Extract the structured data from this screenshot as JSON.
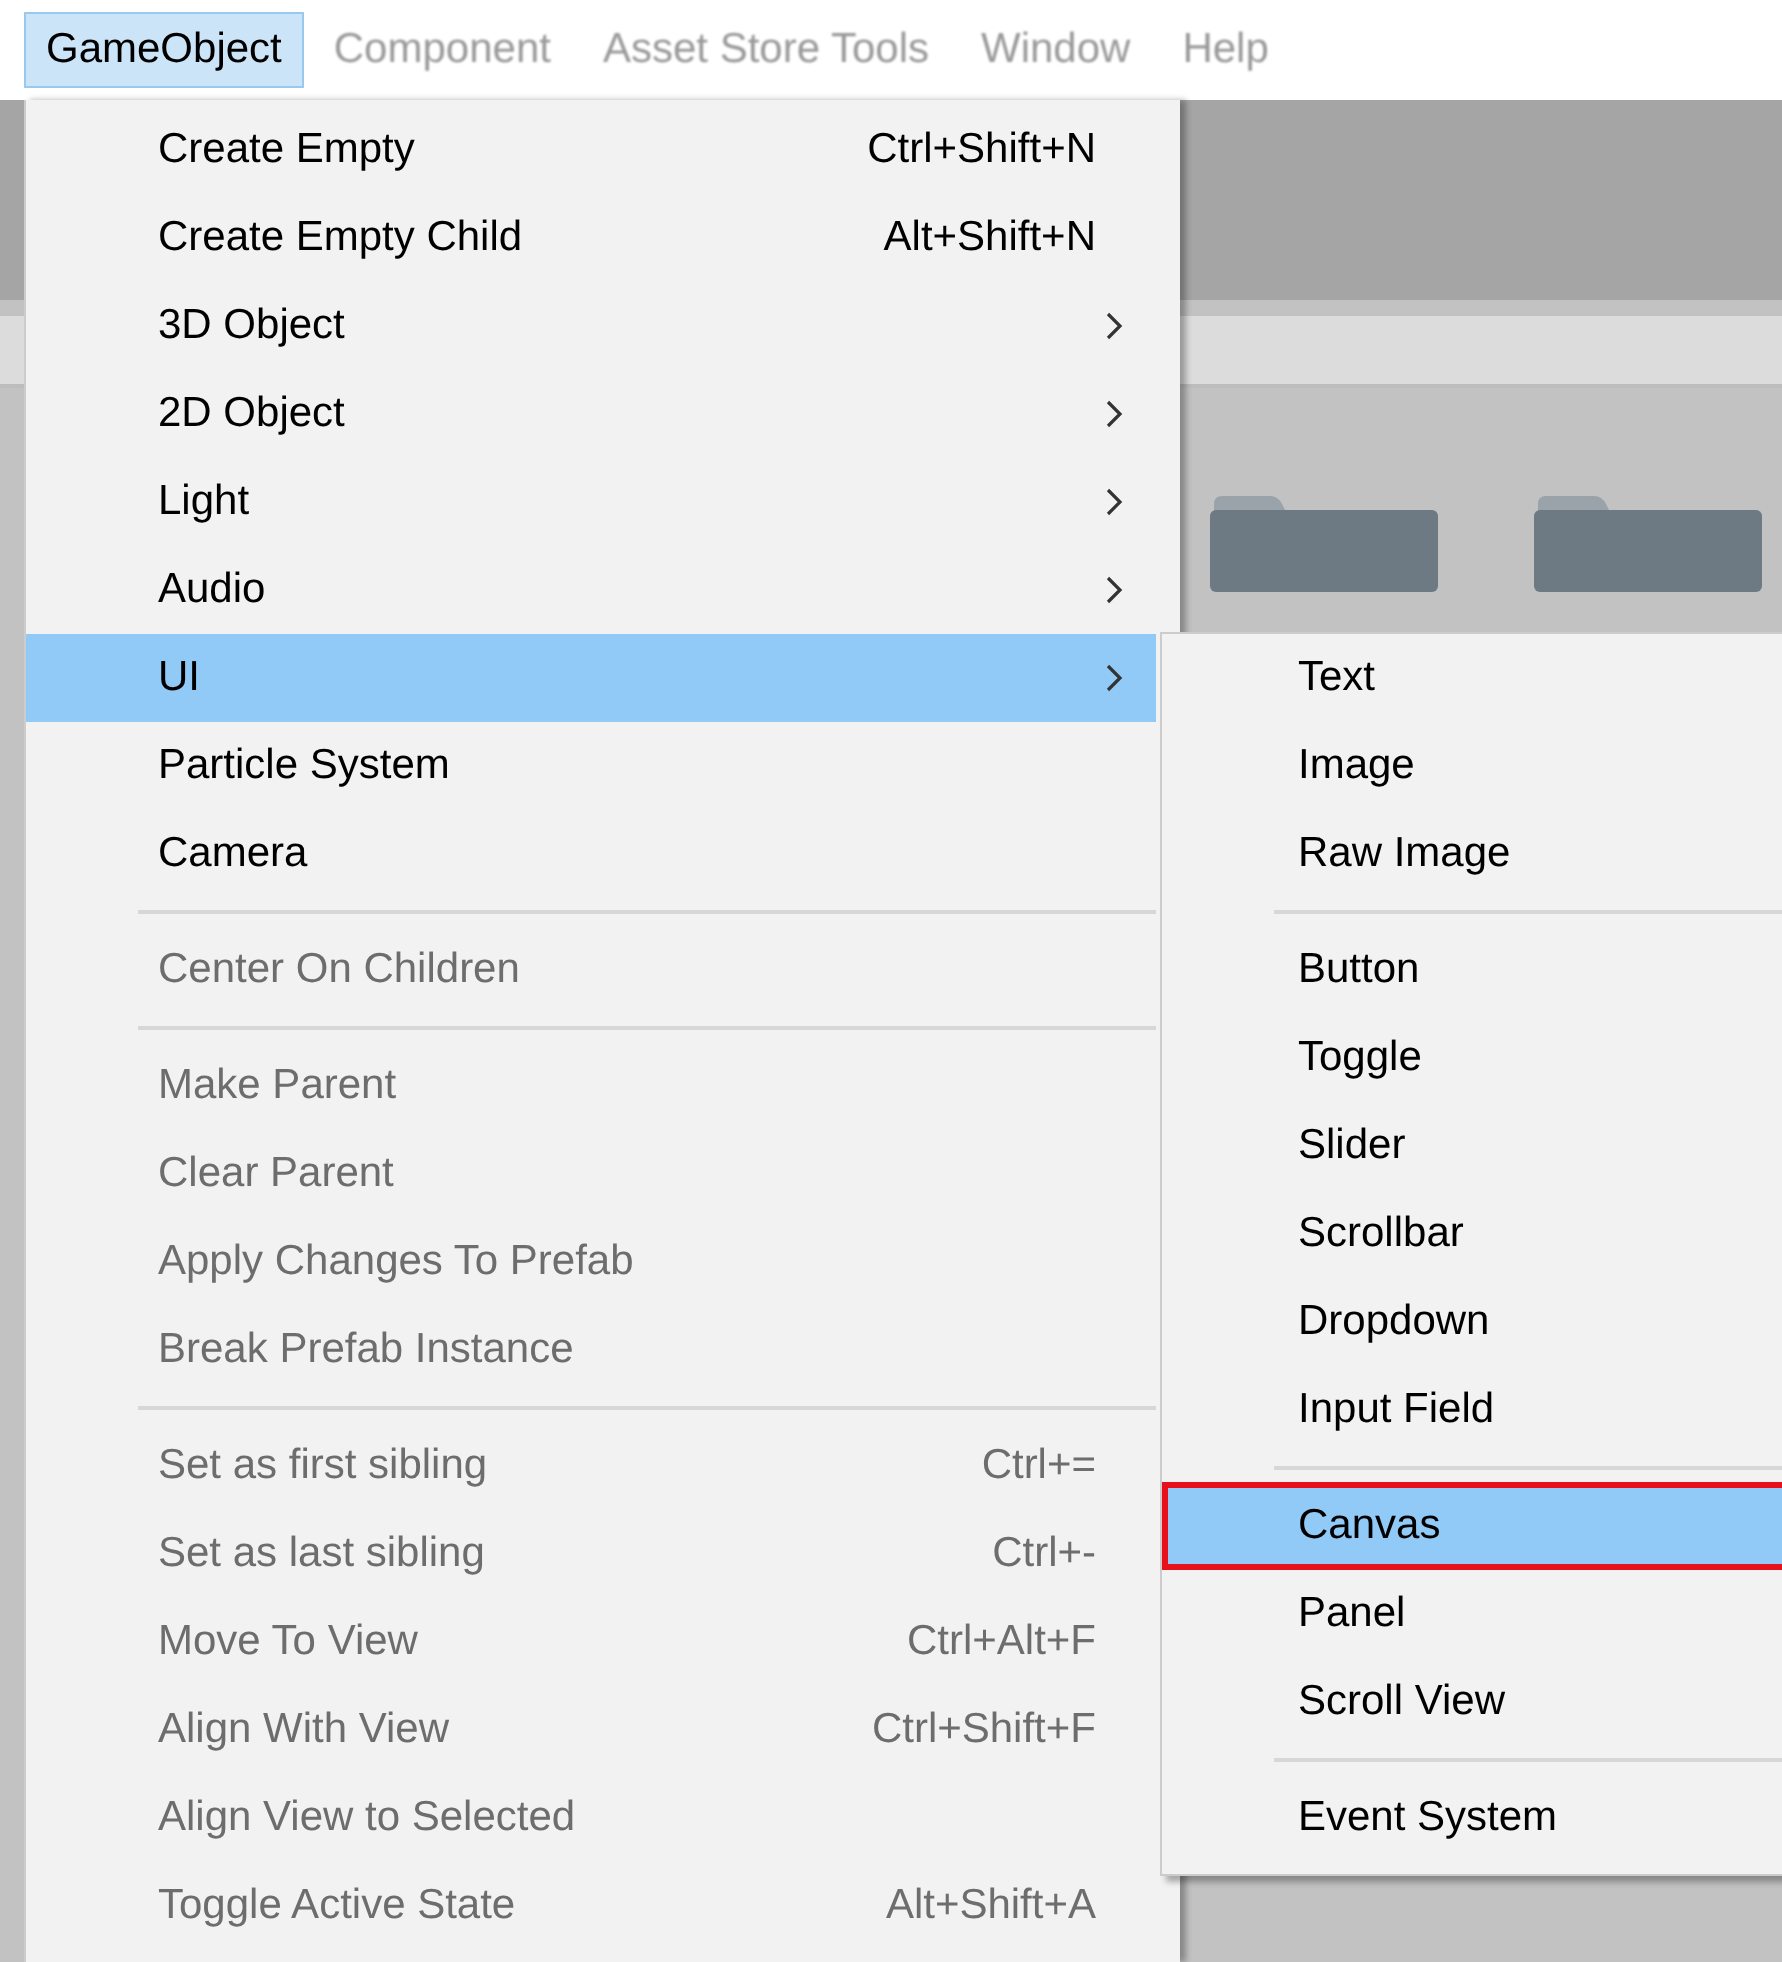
{
  "menu_bar": [
    {
      "label": "GameObject",
      "selected": true,
      "disabled": false
    },
    {
      "label": "Component",
      "selected": false,
      "disabled": true
    },
    {
      "label": "Asset Store Tools",
      "selected": false,
      "disabled": true
    },
    {
      "label": "Window",
      "selected": false,
      "disabled": true
    },
    {
      "label": "Help",
      "selected": false,
      "disabled": true
    }
  ],
  "main_menu": {
    "items": [
      {
        "kind": "item",
        "label": "Create Empty",
        "shortcut": "Ctrl+Shift+N",
        "submenu": false,
        "disabled": false,
        "selected": false
      },
      {
        "kind": "item",
        "label": "Create Empty Child",
        "shortcut": "Alt+Shift+N",
        "submenu": false,
        "disabled": false,
        "selected": false
      },
      {
        "kind": "item",
        "label": "3D Object",
        "submenu": true,
        "disabled": false,
        "selected": false
      },
      {
        "kind": "item",
        "label": "2D Object",
        "submenu": true,
        "disabled": false,
        "selected": false
      },
      {
        "kind": "item",
        "label": "Light",
        "submenu": true,
        "disabled": false,
        "selected": false
      },
      {
        "kind": "item",
        "label": "Audio",
        "submenu": true,
        "disabled": false,
        "selected": false
      },
      {
        "kind": "item",
        "label": "UI",
        "submenu": true,
        "disabled": false,
        "selected": true
      },
      {
        "kind": "item",
        "label": "Particle System",
        "submenu": false,
        "disabled": false,
        "selected": false
      },
      {
        "kind": "item",
        "label": "Camera",
        "submenu": false,
        "disabled": false,
        "selected": false
      },
      {
        "kind": "separator"
      },
      {
        "kind": "item",
        "label": "Center On Children",
        "submenu": false,
        "disabled": true,
        "selected": false
      },
      {
        "kind": "separator"
      },
      {
        "kind": "item",
        "label": "Make Parent",
        "submenu": false,
        "disabled": true,
        "selected": false
      },
      {
        "kind": "item",
        "label": "Clear Parent",
        "submenu": false,
        "disabled": true,
        "selected": false
      },
      {
        "kind": "item",
        "label": "Apply Changes To Prefab",
        "submenu": false,
        "disabled": true,
        "selected": false
      },
      {
        "kind": "item",
        "label": "Break Prefab Instance",
        "submenu": false,
        "disabled": true,
        "selected": false
      },
      {
        "kind": "separator"
      },
      {
        "kind": "item",
        "label": "Set as first sibling",
        "shortcut": "Ctrl+=",
        "submenu": false,
        "disabled": true,
        "selected": false
      },
      {
        "kind": "item",
        "label": "Set as last sibling",
        "shortcut": "Ctrl+-",
        "submenu": false,
        "disabled": true,
        "selected": false
      },
      {
        "kind": "item",
        "label": "Move To View",
        "shortcut": "Ctrl+Alt+F",
        "submenu": false,
        "disabled": true,
        "selected": false
      },
      {
        "kind": "item",
        "label": "Align With View",
        "shortcut": "Ctrl+Shift+F",
        "submenu": false,
        "disabled": true,
        "selected": false
      },
      {
        "kind": "item",
        "label": "Align View to Selected",
        "submenu": false,
        "disabled": true,
        "selected": false
      },
      {
        "kind": "item",
        "label": "Toggle Active State",
        "shortcut": "Alt+Shift+A",
        "submenu": false,
        "disabled": true,
        "selected": false
      }
    ]
  },
  "ui_submenu": {
    "items": [
      {
        "kind": "item",
        "label": "Text",
        "selected": false,
        "marked": false
      },
      {
        "kind": "item",
        "label": "Image",
        "selected": false,
        "marked": false
      },
      {
        "kind": "item",
        "label": "Raw Image",
        "selected": false,
        "marked": false
      },
      {
        "kind": "separator"
      },
      {
        "kind": "item",
        "label": "Button",
        "selected": false,
        "marked": false
      },
      {
        "kind": "item",
        "label": "Toggle",
        "selected": false,
        "marked": false
      },
      {
        "kind": "item",
        "label": "Slider",
        "selected": false,
        "marked": false
      },
      {
        "kind": "item",
        "label": "Scrollbar",
        "selected": false,
        "marked": false
      },
      {
        "kind": "item",
        "label": "Dropdown",
        "selected": false,
        "marked": false
      },
      {
        "kind": "item",
        "label": "Input Field",
        "selected": false,
        "marked": false
      },
      {
        "kind": "separator"
      },
      {
        "kind": "item",
        "label": "Canvas",
        "selected": true,
        "marked": true
      },
      {
        "kind": "item",
        "label": "Panel",
        "selected": false,
        "marked": false
      },
      {
        "kind": "item",
        "label": "Scroll View",
        "selected": false,
        "marked": false
      },
      {
        "kind": "separator"
      },
      {
        "kind": "item",
        "label": "Event System",
        "selected": false,
        "marked": false
      }
    ]
  }
}
